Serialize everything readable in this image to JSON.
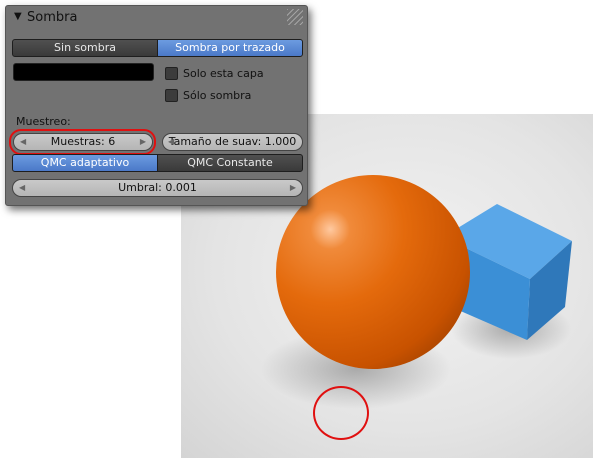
{
  "panel": {
    "title": "Sombra",
    "shadow_modes": {
      "none": "Sin sombra",
      "ray": "Sombra por trazado"
    },
    "options": {
      "this_layer": "Solo esta capa",
      "only_shadow": "Sólo sombra"
    },
    "sampling": {
      "label": "Muestreo:",
      "samples": "Muestras: 6",
      "soft_size": "Tamaño de suav: 1.000",
      "qmc_adaptive": "QMC adaptativo",
      "qmc_constant": "QMC Constante",
      "threshold": "Umbral: 0.001"
    }
  },
  "colors": {
    "panel_bg": "#727272",
    "selected_blue": "#5a88d4",
    "highlight_red": "#e01010",
    "sphere": "#e8680a",
    "cube": "#3b8fd6"
  },
  "icons": {
    "collapse": "triangle-down",
    "grip": "diagonal-lines"
  }
}
